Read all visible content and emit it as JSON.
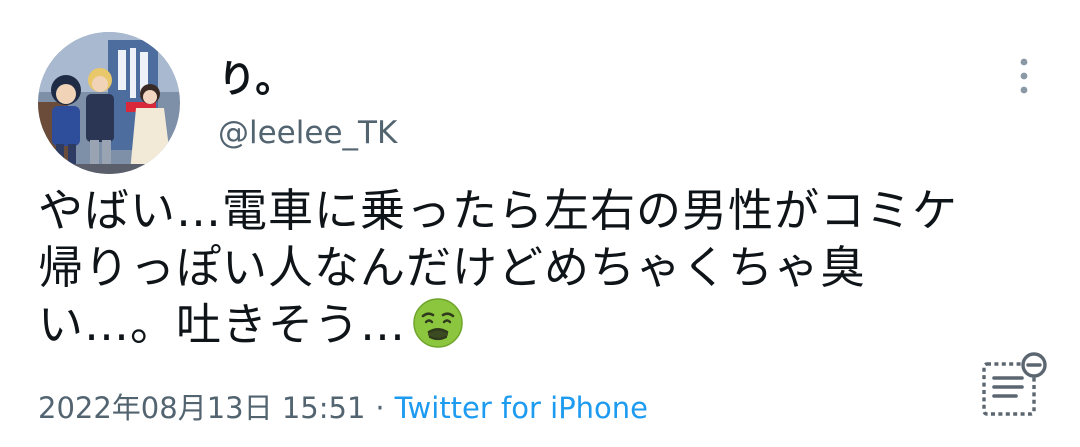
{
  "tweet": {
    "display_name": "り。",
    "handle": "@leelee_TK",
    "text_lines": [
      "やばい…電車に乗ったら左右の男性がコミケ",
      "帰りっぽい人なんだけどめちゃくちゃ臭",
      "い…。吐きそう…"
    ],
    "emoji": "nauseated-face",
    "timestamp": "2022年08月13日 15:51",
    "separator": "·",
    "source": "Twitter for iPhone"
  },
  "icons": {
    "more": "more-vertical-icon",
    "thread_reader": "thread-reader-icon"
  },
  "colors": {
    "text": "#0f1419",
    "secondary": "#536471",
    "link": "#1d9bf0",
    "emoji_face": "#8cc63e"
  }
}
